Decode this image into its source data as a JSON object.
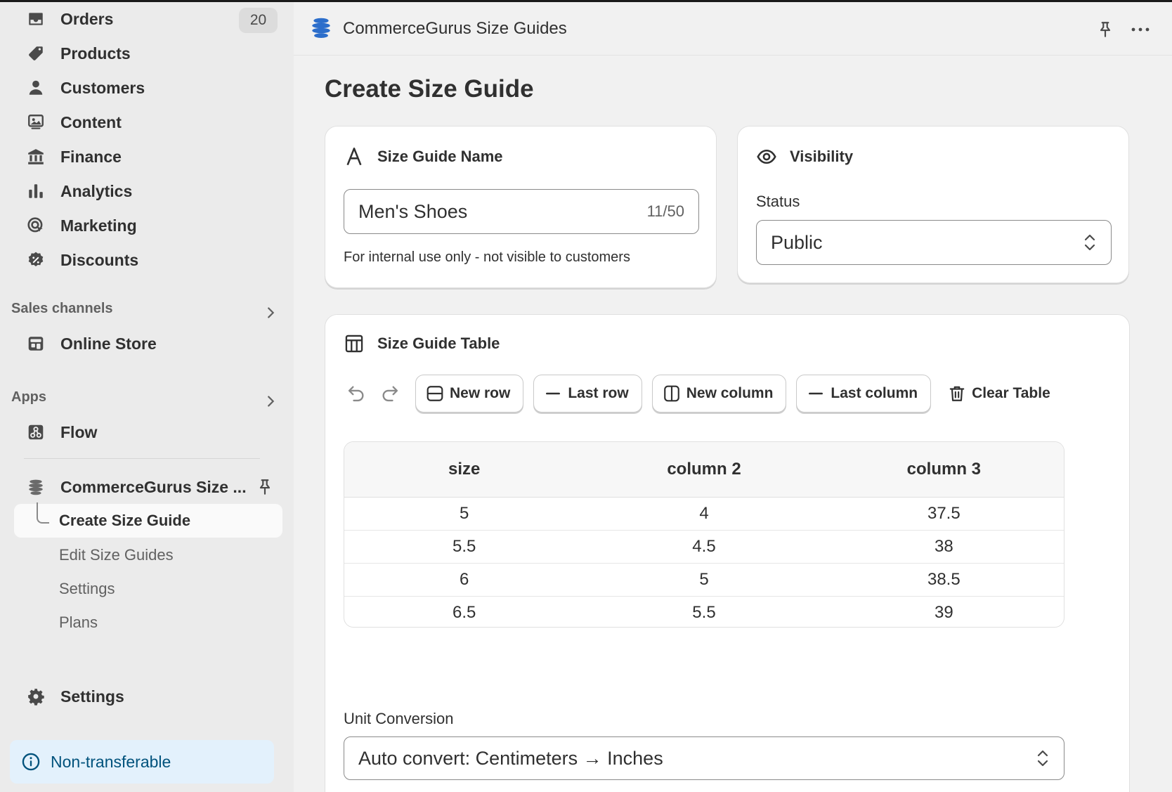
{
  "sidebar": {
    "nav": [
      {
        "label": "Orders",
        "icon": "inbox-icon",
        "badge": "20"
      },
      {
        "label": "Products",
        "icon": "tag-icon"
      },
      {
        "label": "Customers",
        "icon": "person-icon"
      },
      {
        "label": "Content",
        "icon": "image-icon"
      },
      {
        "label": "Finance",
        "icon": "bank-icon"
      },
      {
        "label": "Analytics",
        "icon": "bar-chart-icon"
      },
      {
        "label": "Marketing",
        "icon": "target-icon"
      },
      {
        "label": "Discounts",
        "icon": "discount-icon"
      }
    ],
    "sales_channels_label": "Sales channels",
    "online_store_label": "Online Store",
    "apps_label": "Apps",
    "flow_label": "Flow",
    "app_name": "CommerceGurus Size ...",
    "sub_items": [
      {
        "label": "Create Size Guide",
        "active": true
      },
      {
        "label": "Edit Size Guides"
      },
      {
        "label": "Settings"
      },
      {
        "label": "Plans"
      }
    ],
    "settings_label": "Settings",
    "non_transferable_label": "Non-transferable"
  },
  "app_bar": {
    "title": "CommerceGurus Size Guides"
  },
  "page": {
    "title": "Create Size Guide"
  },
  "name_card": {
    "heading": "Size Guide Name",
    "value": "Men's Shoes",
    "counter": "11/50",
    "help": "For internal use only - not visible to customers"
  },
  "visibility_card": {
    "heading": "Visibility",
    "status_label": "Status",
    "status_value": "Public"
  },
  "table_card": {
    "heading": "Size Guide Table",
    "buttons": {
      "new_row": "New row",
      "last_row": "Last row",
      "new_column": "New column",
      "last_column": "Last column",
      "clear_table": "Clear Table"
    },
    "columns": [
      "size",
      "column 2",
      "column 3"
    ],
    "rows": [
      [
        "5",
        "4",
        "37.5"
      ],
      [
        "5.5",
        "4.5",
        "38"
      ],
      [
        "6",
        "5",
        "38.5"
      ],
      [
        "6.5",
        "5.5",
        "39"
      ]
    ],
    "unit_label": "Unit Conversion",
    "unit_value": "Auto convert: Centimeters → Inches"
  },
  "colors": {
    "accent_blue": "#2c6ecb",
    "info_bg": "#e3f1fc",
    "info_text": "#00527c"
  }
}
